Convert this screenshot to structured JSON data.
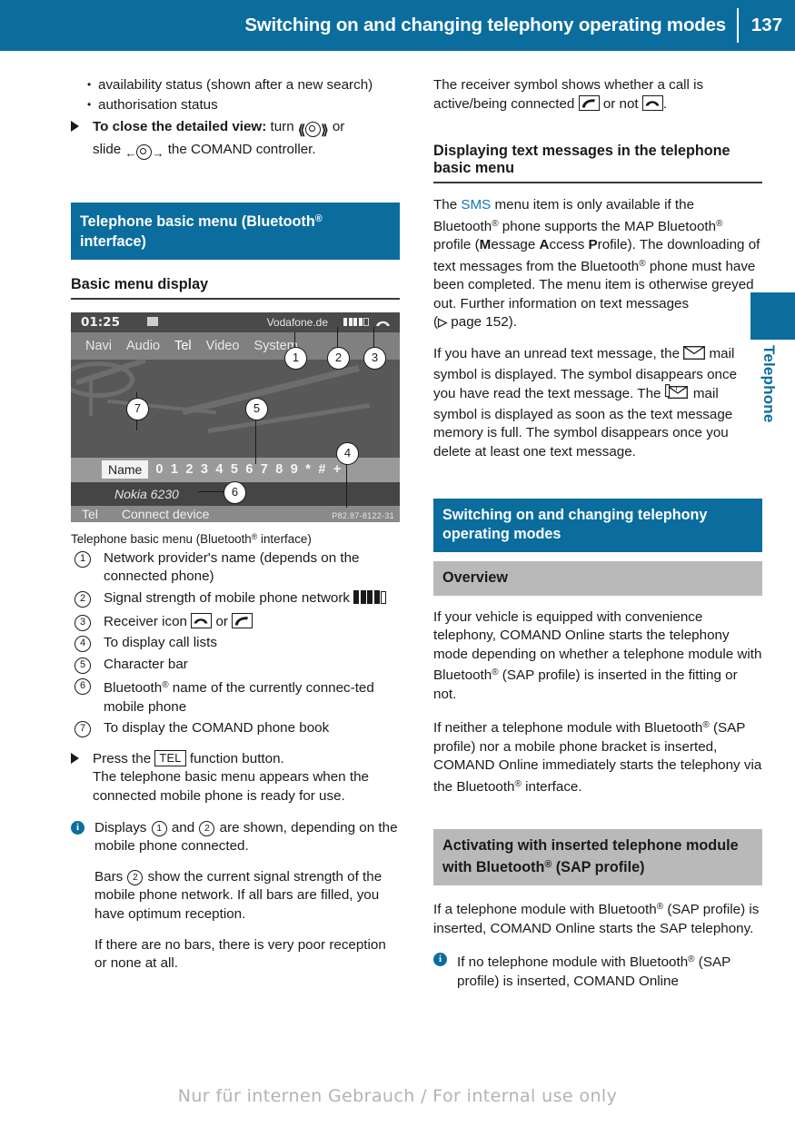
{
  "header": {
    "title": "Switching on and changing telephony operating modes",
    "page_number": "137",
    "bg_color": "#0a6d9e"
  },
  "chapter_tab": {
    "label": "Telephone",
    "color": "#0a6d9e"
  },
  "left_column": {
    "bullets": [
      "availability status (shown after a new search)",
      "authorisation status"
    ],
    "step_close": {
      "bold_lead": "To close the detailed view:",
      "text_mid": " turn ",
      "text_after_turn": " or",
      "text_line2_pre": "slide ",
      "text_line2_post": " the COMAND controller."
    },
    "heading_blue": "Telephone basic menu (Bluetooth® interface)",
    "heading_blue_plain": "Telephone basic menu (Bluetooth",
    "heading_blue_tail": " interface)",
    "heading_rule": "Basic menu display",
    "figure": {
      "clock": "01:25",
      "carrier": "Vodafone.de",
      "menu_items": [
        "Navi",
        "Audio",
        "Tel",
        "Video",
        "System"
      ],
      "name_button": "Name",
      "character_bar": "0 1 2 3 4 5 6 7 8 9 * # +",
      "device_name": "Nokia 6230",
      "bottom_left": "Tel",
      "bottom_right": "Connect device",
      "figure_code": "P82.87-8122-31",
      "callouts": [
        "1",
        "2",
        "3",
        "4",
        "5",
        "6",
        "7"
      ]
    },
    "figure_caption_pre": "Telephone basic menu (Bluetooth",
    "figure_caption_post": " interface)",
    "key_items": [
      {
        "num": "1",
        "text": "Network provider's name (depends on the connected phone)"
      },
      {
        "num": "2",
        "text": "Signal strength of mobile phone network"
      },
      {
        "num": "3",
        "text": "Receiver icon"
      },
      {
        "num": "4",
        "text": "To display call lists"
      },
      {
        "num": "5",
        "text": "Character bar"
      },
      {
        "num": "6",
        "text": "Bluetooth® name of the currently connected mobile phone"
      },
      {
        "num": "7",
        "text": "To display the COMAND phone book"
      }
    ],
    "key3_or": " or ",
    "key6_pre": "Bluetooth",
    "key6_post": " name of the currently connec-​ted mobile phone",
    "step_press": {
      "pre": "Press the ",
      "keycap": "TEL",
      "post": " function button.",
      "result": "The telephone basic menu appears when the connected mobile phone is ready for use."
    },
    "note": {
      "p1_a": "Displays ",
      "p1_b": " and ",
      "p1_c": " are shown, depending on the mobile phone connected.",
      "p2_a": "Bars ",
      "p2_b": " show the current signal strength of the mobile phone network. If all bars are filled, you have optimum reception.",
      "p3": "If there are no bars, there is very poor reception or none at all."
    }
  },
  "right_column": {
    "receiver_para_pre": "The receiver symbol shows whether a call is active/being connected ",
    "receiver_para_mid": " or not ",
    "receiver_para_post": ".",
    "heading_sms_rule": "Displaying text messages in the telephone basic menu",
    "sms_para": {
      "pre": "The ",
      "blue": "SMS",
      "post_1": " menu item is only available if the Bluetooth",
      "post_2": " phone supports the MAP Bluetooth",
      "post_3": " profile (",
      "bold_m": "M",
      "rest_m": "essage ",
      "bold_a": "A",
      "rest_a": "ccess ",
      "bold_p": "P",
      "rest_p": "rofile). The downloading of text messages from the Bluetooth",
      "post_4": " phone must have been completed. The menu item is otherwise greyed out. Further information on text messages",
      "ref": "page 152)."
    },
    "unread_para": {
      "p1": "If you have an unread text message, the ",
      "p2": " mail symbol is displayed. The symbol disappears once you have read the text message. The ",
      "p3": " mail symbol is displayed as soon as the text message memory is full. The symbol disappears once you delete at least one text message."
    },
    "heading_blue": "Switching on and changing telephony operating modes",
    "heading_grey_overview": "Overview",
    "overview_p1_pre": "If your vehicle is equipped with convenience telephony, COMAND Online starts the telephony mode depending on whether a telephone module with Bluetooth",
    "overview_p1_post": " (SAP profile) is inserted in the fitting or not.",
    "overview_p2_pre": "If neither a telephone module with Bluetooth",
    "overview_p2_mid": " (SAP profile) nor a mobile phone bracket is inserted, COMAND Online immediately starts the telephony via the Bluetooth",
    "overview_p2_post": " interface.",
    "heading_grey_activating_pre": "Activating with inserted telephone module with Bluetooth",
    "heading_grey_activating_post": " (SAP profile)",
    "activating_p1_pre": "If a telephone module with Bluetooth",
    "activating_p1_post": " (SAP profile) is inserted, COMAND Online starts the SAP telephony.",
    "activating_note_pre": "If no telephone module with Bluetooth",
    "activating_note_post": " (SAP profile) is inserted, COMAND Online"
  },
  "footer": {
    "watermark": "Nur für internen Gebrauch / For internal use only"
  },
  "colors": {
    "accent_blue": "#0a6d9e",
    "grey_heading": "#b9b9b9",
    "sms_blue": "#1577b4"
  }
}
